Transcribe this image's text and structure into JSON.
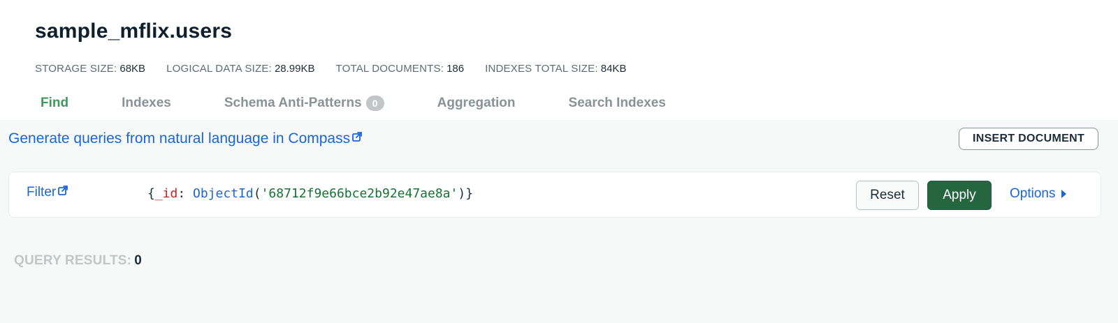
{
  "collection": {
    "title": "sample_mflix.users"
  },
  "stats": [
    {
      "label": "STORAGE SIZE:",
      "value": "68KB"
    },
    {
      "label": "LOGICAL DATA SIZE:",
      "value": "28.99KB"
    },
    {
      "label": "TOTAL DOCUMENTS:",
      "value": "186"
    },
    {
      "label": "INDEXES TOTAL SIZE:",
      "value": "84KB"
    }
  ],
  "tabs": [
    {
      "label": "Find",
      "active": true
    },
    {
      "label": "Indexes"
    },
    {
      "label": "Schema Anti-Patterns",
      "badge": "0"
    },
    {
      "label": "Aggregation"
    },
    {
      "label": "Search Indexes"
    }
  ],
  "toolbar": {
    "nl_link": "Generate queries from natural language in Compass",
    "insert_button": "INSERT DOCUMENT"
  },
  "query": {
    "filter_label": "Filter",
    "filter_tokens": {
      "open": "{",
      "key": "_id",
      "colon": ": ",
      "fn": "ObjectId",
      "paren_open": "(",
      "str": "'68712f9e66bce2b92e47ae8a'",
      "paren_close": ")",
      "close": "}"
    },
    "reset_label": "Reset",
    "apply_label": "Apply",
    "options_label": "Options"
  },
  "results": {
    "label": "QUERY RESULTS:",
    "count": "0"
  },
  "colors": {
    "accent_green": "#3d9a5b",
    "apply_green": "#25653f",
    "link_blue": "#1a66d6"
  },
  "icons": {
    "external_link": "external-link-icon",
    "options_caret": "caret-right-icon"
  }
}
